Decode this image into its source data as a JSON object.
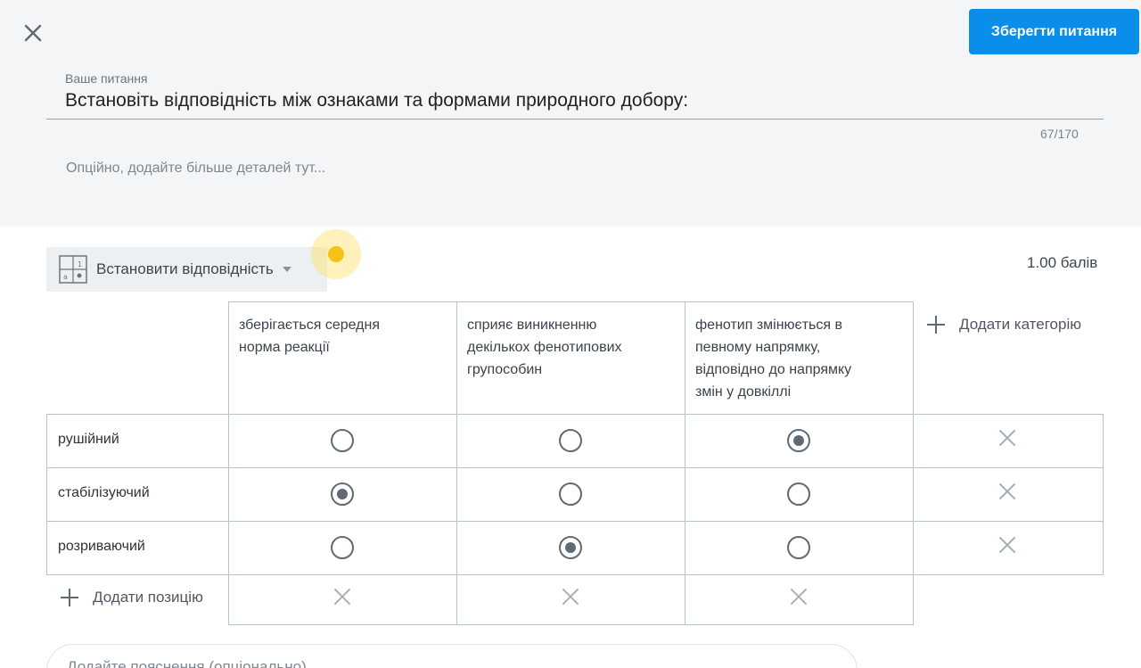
{
  "header": {
    "close_icon": "close-icon",
    "save_label": "Зберегти питання"
  },
  "question": {
    "label": "Ваше питання",
    "text": "Встановіть відповідність між ознаками та формами природного добору:",
    "counter": "67/170",
    "details_placeholder": "Опційно, додайте більше деталей тут..."
  },
  "question_type": {
    "label": "Встановити відповідність",
    "icon": "match-grid-icon"
  },
  "points": "1.00 балів",
  "matrix": {
    "columns": [
      "зберігається середня норма реакції",
      "сприяє виникненню декількох фенотипових групособин",
      "фенотип змінюється в певному напрямку, відповідно до напрямку змін у довкіллі"
    ],
    "column_lines": [
      [
        "зберігається середня",
        "норма реакції"
      ],
      [
        "сприяє виникненню",
        "декількох фенотипових",
        "групособин"
      ],
      [
        "фенотип змінюється в",
        "певному напрямку,",
        "відповідно до напрямку",
        "змін у довкіллі"
      ]
    ],
    "rows": [
      "рушійний",
      "стабілізуючий",
      "розриваючий"
    ],
    "selected": [
      2,
      0,
      1
    ],
    "add_category_label": "Додати категорію",
    "add_position_label": "Додати позицію"
  },
  "explanation_placeholder": "Додайте пояснення (опціонально)"
}
